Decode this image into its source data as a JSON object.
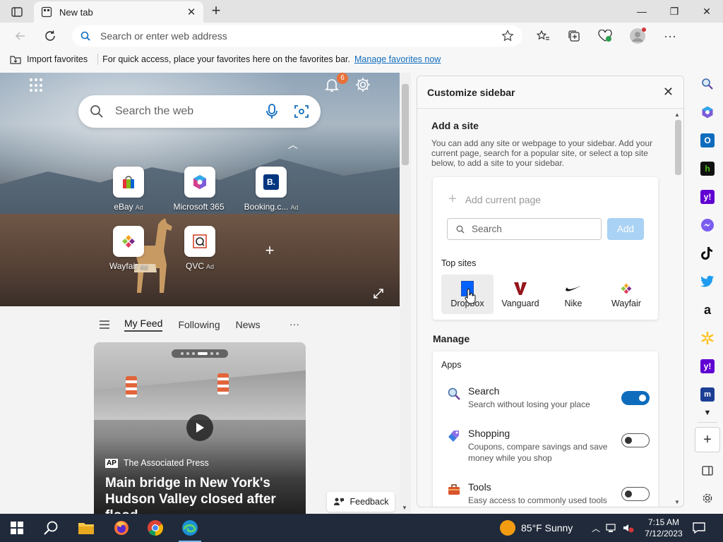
{
  "browser": {
    "tab_title": "New tab",
    "address_placeholder": "Search or enter web address"
  },
  "favorites_bar": {
    "import_label": "Import favorites",
    "hint": "For quick access, place your favorites here on the favorites bar.",
    "manage_link": "Manage favorites now"
  },
  "newtab": {
    "notification_count": "6",
    "search_placeholder": "Search the web",
    "quick_links": [
      {
        "label": "eBay",
        "ad": "Ad"
      },
      {
        "label": "Microsoft 365",
        "ad": ""
      },
      {
        "label": "Booking.c...",
        "ad": "Ad"
      },
      {
        "label": "Wayfair",
        "ad": "Ad"
      },
      {
        "label": "QVC",
        "ad": "Ad"
      }
    ],
    "feed_tabs": [
      "My Feed",
      "Following",
      "News"
    ],
    "feed_more": "···",
    "card": {
      "source": "The Associated Press",
      "source_logo": "AP",
      "headline": "Main bridge in New York's Hudson Valley closed after flood..."
    },
    "feedback_label": "Feedback"
  },
  "customize_panel": {
    "title": "Customize sidebar",
    "add_site_title": "Add a site",
    "add_site_desc": "You can add any site or webpage to your sidebar. Add your current page, search for a popular site, or select a top site below, to add a site to your sidebar.",
    "add_current_page": "Add current page",
    "search_placeholder": "Search",
    "add_button": "Add",
    "top_sites_label": "Top sites",
    "top_sites": [
      "Dropbox",
      "Vanguard",
      "Nike",
      "Wayfair"
    ],
    "manage_title": "Manage",
    "apps_label": "Apps",
    "apps": [
      {
        "name": "Search",
        "desc": "Search without losing your place",
        "enabled": true
      },
      {
        "name": "Shopping",
        "desc": "Coupons, compare savings and save money while you shop",
        "enabled": false
      },
      {
        "name": "Tools",
        "desc": "Easy access to commonly used tools",
        "enabled": false
      }
    ]
  },
  "sidebar_icons": [
    "search-icon",
    "copilot-icon",
    "outlook-icon",
    "houzz-icon",
    "yahoo-icon",
    "messenger-icon",
    "tiktok-icon",
    "twitter-icon",
    "amazon-icon",
    "walmart-icon",
    "yahoo-icon",
    "marriott-icon"
  ],
  "taskbar": {
    "weather": "85°F  Sunny",
    "time": "7:15 AM",
    "date": "7/12/2023"
  },
  "colors": {
    "accent": "#0f6cbd",
    "taskbar": "#202a3a"
  }
}
